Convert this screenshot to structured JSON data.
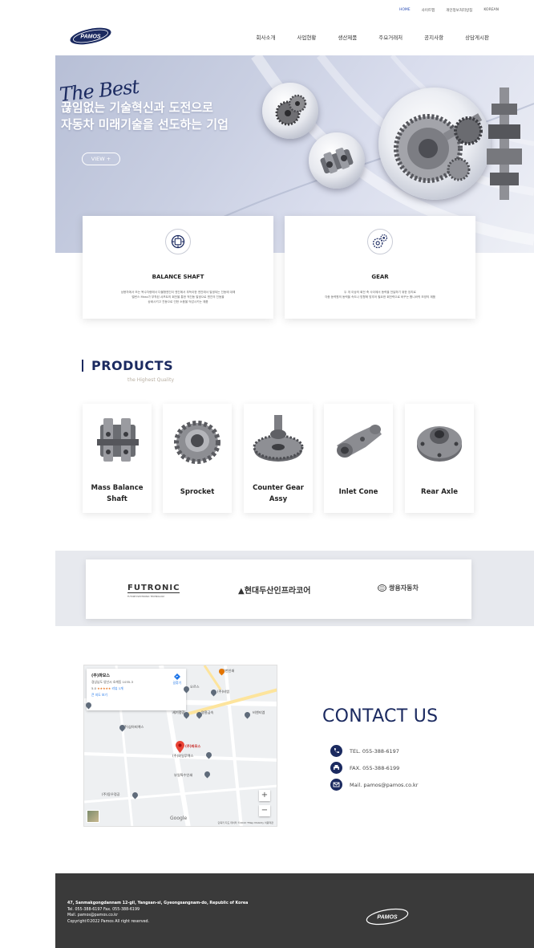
{
  "utility": {
    "home": "HOME",
    "sitemap": "사이트맵",
    "privacy": "개인정보처리방침",
    "lang": "KOREAN"
  },
  "brand": {
    "logo_text": "PAMOS"
  },
  "nav": [
    "회사소개",
    "사업현황",
    "생산제품",
    "주요거래처",
    "공지사항",
    "상담게시판"
  ],
  "hero": {
    "script": "The Best",
    "line1": "끊임없는 기술혁신과 도전으로",
    "line2": "자동차 미래기술을 선도하는 기업",
    "button": "VIEW +"
  },
  "features": [
    {
      "title": "BALANCE SHAFT",
      "desc1": "상용차에서 또는 목수차량에서 다물형엔진이 엔진에서 부득이한 엔진에서 발생되는 진동에 대해",
      "desc2": "밸런스 Mass가 부착된 샤프트의 회전을 통한 적진동 발생으로 엔진의 진동을",
      "desc3": "상쇄시키고 진동으로 인한 소음을 억감시키는 제품"
    },
    {
      "title": "GEAR",
      "desc1": "두 개 이상의 회전 축 사이에서 동력을 전달하기 위한 장치로",
      "desc2": "각종 동력원의 동력을 속도나 방향에 맞추어 필요한 회전력으로 바꾸는 톱니바퀴 모양의 제품",
      "desc3": ""
    }
  ],
  "products": {
    "title": "PRODUCTS",
    "subtitle": "the Highest Quality",
    "items": [
      {
        "line1": "Mass Balance",
        "line2": "Shaft"
      },
      {
        "line1": "Sprocket",
        "line2": ""
      },
      {
        "line1": "Counter Gear",
        "line2": "Assy"
      },
      {
        "line1": "Inlet Cone",
        "line2": ""
      },
      {
        "line1": "Rear Axle",
        "line2": ""
      }
    ]
  },
  "partners": {
    "futronic": "FUTRONIC",
    "futronic_sub": "FUTURE ELECTRONIC TECHNOLOGY",
    "doosan": "▲현대두산인프라코어",
    "ssangyong": "쌍용자동차"
  },
  "map": {
    "name": "(주)파모스",
    "address": "경상남도 양산시 호계동 1035-3",
    "rating": "5.0",
    "stars": "★★★★★",
    "reviews": "리뷰 1개",
    "larger": "큰 지도 보기",
    "directions": "길찾기",
    "marker": "(주)파모스",
    "labels": [
      "오르스",
      "(주)비엠",
      "세기정공",
      "명흥금속",
      "(주)삼아피엑스",
      "(주)와일루텍스",
      "부일특수인쇄",
      "(주)동우정공",
      "우월한인쇄",
      "비앤티엠"
    ],
    "google": "Google",
    "terms": "단축키   지도 데이터 ©2022 TMap Mobility   이용약관"
  },
  "contact": {
    "title": "CONTACT US",
    "tel": "TEL. 055-388-6197",
    "fax": "FAX. 055-388-6199",
    "mail": "Mail. pamos@pamos.co.kr"
  },
  "footer": {
    "address": "47, Sanmakgongdannam 12-gil, Yangsan-si, Gyeongsangnam-do, Republic of Korea",
    "telfax": "Tel. 055-388-6197 Fax. 055-388-6199",
    "mail": "Mail. pamos@pamos.co.kr",
    "copyright": "Copyright©2022 Pamos All right reserved."
  },
  "colors": {
    "navy": "#1b2a60",
    "footer": "#3a3a3a",
    "accent": "#2a4db5"
  }
}
